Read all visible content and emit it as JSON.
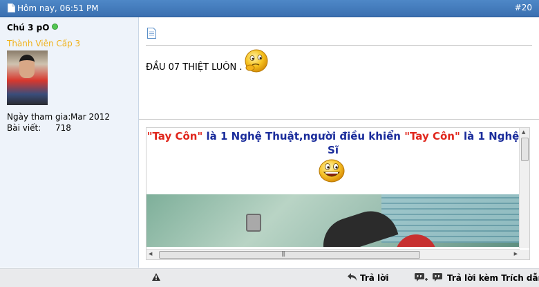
{
  "header": {
    "date": "Hôm nay, 06:51 PM",
    "post_number": "#20"
  },
  "user": {
    "name": "Chú 3 pO",
    "rank": "Thành Viên Cấp 3",
    "join_label": "Ngày tham gia:",
    "join_value": "Mar 2012",
    "posts_label": "Bài viết:",
    "posts_value": "718"
  },
  "post": {
    "message": "ĐẦU 07 THIỆT LUÔN ."
  },
  "signature": {
    "part1": "\"Tay Côn\"",
    "part2": " là 1 Nghệ Thuật,người điều khiển ",
    "part3": "\"Tay Côn\"",
    "part4": " là 1 Nghệ Sĩ"
  },
  "footer": {
    "reply_label": "Trả lời",
    "quote_reply_label": "Trả lời kèm Trích dẫn"
  },
  "colors": {
    "header_bg": "#3a6fb0",
    "rank": "#f0b21c",
    "signature_red": "#e0261c",
    "signature_blue": "#1a2c9b",
    "online": "#53c653"
  },
  "icons": [
    "document-icon",
    "post-icon",
    "online-indicator",
    "thinking-smiley",
    "grinning-smiley",
    "report-icon",
    "reply-icon",
    "multi-quote-icon",
    "quote-icon"
  ]
}
